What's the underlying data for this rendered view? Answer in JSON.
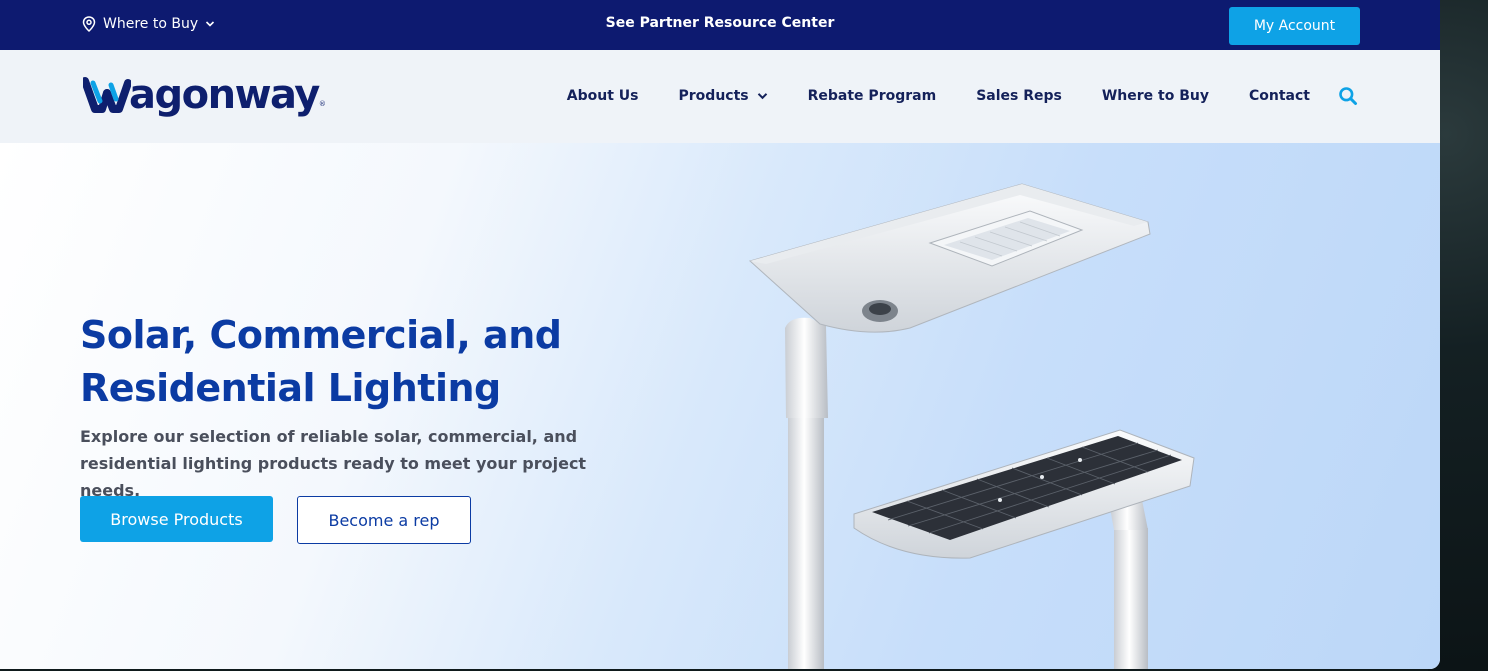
{
  "topbar": {
    "where_to_buy": "Where to Buy",
    "partner_link": "See Partner Resource Center",
    "account_button": "My Account"
  },
  "brand": {
    "name": "agonway",
    "registered": "®"
  },
  "nav": {
    "items": [
      {
        "label": "About Us"
      },
      {
        "label": "Products"
      },
      {
        "label": "Rebate Program"
      },
      {
        "label": "Sales Reps"
      },
      {
        "label": "Where to Buy"
      },
      {
        "label": "Contact"
      }
    ]
  },
  "hero": {
    "title_line1": "Solar, Commercial, and",
    "title_line2": "Residential Lighting",
    "description": "Explore our selection of reliable solar, commercial, and residential lighting products ready to meet your project needs.",
    "primary_button": "Browse Products",
    "secondary_button": "Become a rep"
  },
  "colors": {
    "topbar_bg": "#0d1a70",
    "accent": "#0ea2e6",
    "heading": "#0b3ba3",
    "nav_text": "#14215a"
  },
  "icons": [
    "location-pin-icon",
    "chevron-down-icon",
    "search-icon"
  ]
}
